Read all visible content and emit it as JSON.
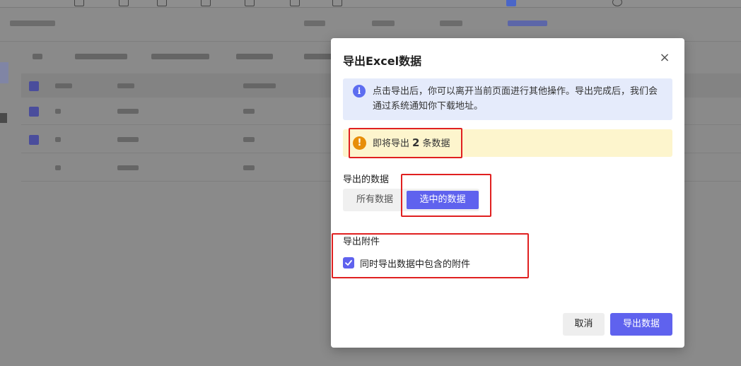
{
  "dialog": {
    "title": "导出Excel数据",
    "close_symbol": "×",
    "info": {
      "icon": "info-icon",
      "icon_glyph": "i",
      "text": "点击导出后，你可以离开当前页面进行其他操作。导出完成后，我们会通过系统通知你下载地址。"
    },
    "warning": {
      "icon": "exclamation-icon",
      "icon_glyph": "!",
      "prefix": "即将导出",
      "count": "2",
      "suffix": "条数据"
    },
    "export_data": {
      "label": "导出的数据",
      "options": [
        "所有数据",
        "选中的数据"
      ],
      "selected": "选中的数据"
    },
    "attachments": {
      "label": "导出附件",
      "checkbox_label": "同时导出数据中包含的附件",
      "checked": true
    },
    "buttons": {
      "cancel": "取消",
      "export": "导出数据"
    }
  },
  "colors": {
    "primary": "#5f62ee",
    "info_bg": "#e5ebfb",
    "warning_bg": "#fdf5cd",
    "warning_icon": "#e78e08",
    "annotation": "#e02020",
    "overlay": "#8a8a8a"
  }
}
